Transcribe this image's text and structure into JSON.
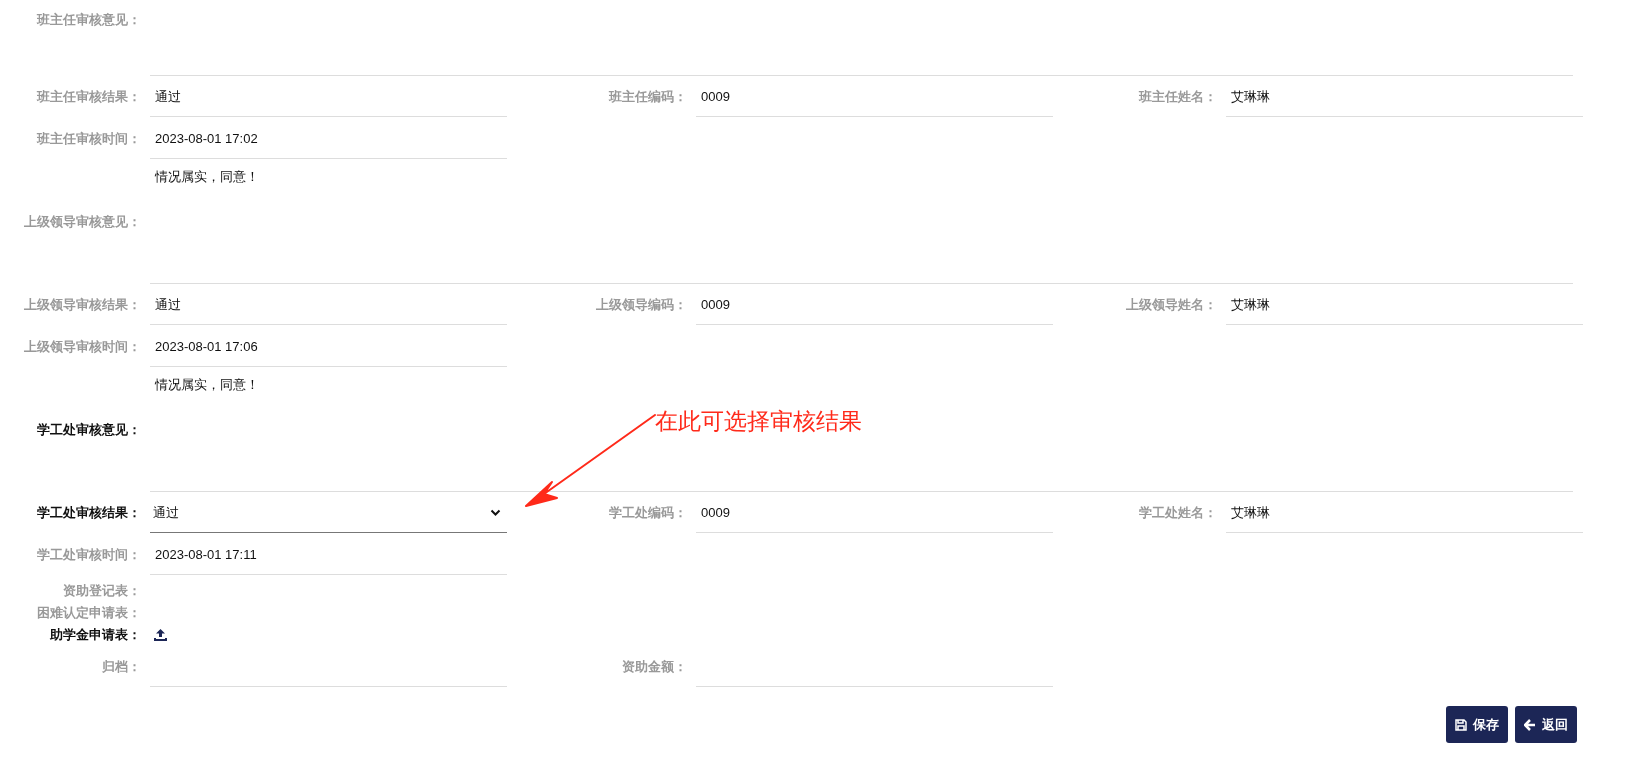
{
  "sections": [
    {
      "opinion": {
        "label": "班主任审核意见：",
        "emphasized": false
      },
      "rows": [
        [
          {
            "label": "班主任审核结果：",
            "value": "通过",
            "kind": "text",
            "emphasized": false
          },
          {
            "label": "班主任编码：",
            "value": "0009",
            "kind": "text",
            "emphasized": false
          },
          {
            "label": "班主任姓名：",
            "value": "艾琳琳",
            "kind": "text",
            "emphasized": false
          }
        ],
        [
          {
            "label": "班主任审核时间：",
            "value": "2023-08-01 17:02",
            "kind": "text",
            "emphasized": false
          }
        ]
      ]
    },
    {
      "opinion": {
        "label": "上级领导审核意见：",
        "value": "情况属实，同意！",
        "emphasized": false
      },
      "rows": [
        [
          {
            "label": "上级领导审核结果：",
            "value": "通过",
            "kind": "text",
            "emphasized": false
          },
          {
            "label": "上级领导编码：",
            "value": "0009",
            "kind": "text",
            "emphasized": false
          },
          {
            "label": "上级领导姓名：",
            "value": "艾琳琳",
            "kind": "text",
            "emphasized": false
          }
        ],
        [
          {
            "label": "上级领导审核时间：",
            "value": "2023-08-01 17:06",
            "kind": "text",
            "emphasized": false
          }
        ]
      ]
    },
    {
      "opinion": {
        "label": "学工处审核意见：",
        "value": "情况属实，同意！",
        "emphasized": true
      },
      "rows": [
        [
          {
            "label": "学工处审核结果：",
            "value": "通过",
            "kind": "select",
            "emphasized": true
          },
          {
            "label": "学工处编码：",
            "value": "0009",
            "kind": "text",
            "emphasized": false
          },
          {
            "label": "学工处姓名：",
            "value": "艾琳琳",
            "kind": "text",
            "emphasized": false
          }
        ],
        [
          {
            "label": "学工处审核时间：",
            "value": "2023-08-01 17:11",
            "kind": "text",
            "emphasized": false
          }
        ]
      ]
    }
  ],
  "attachments": [
    {
      "label": "资助登记表：",
      "kind": "plain",
      "emphasized": false
    },
    {
      "label": "困难认定申请表：",
      "kind": "plain",
      "emphasized": false
    },
    {
      "label": "助学金申请表：",
      "kind": "upload",
      "emphasized": true
    }
  ],
  "archive_row": [
    {
      "label": "归档：",
      "kind": "text",
      "emphasized": false
    },
    {
      "label": "资助金额：",
      "kind": "text",
      "emphasized": false
    }
  ],
  "buttons": [
    {
      "label": "保存",
      "kind": "save"
    },
    {
      "label": "返回",
      "kind": "back"
    }
  ],
  "annotation": {
    "text": "在此可选择审核结果"
  }
}
